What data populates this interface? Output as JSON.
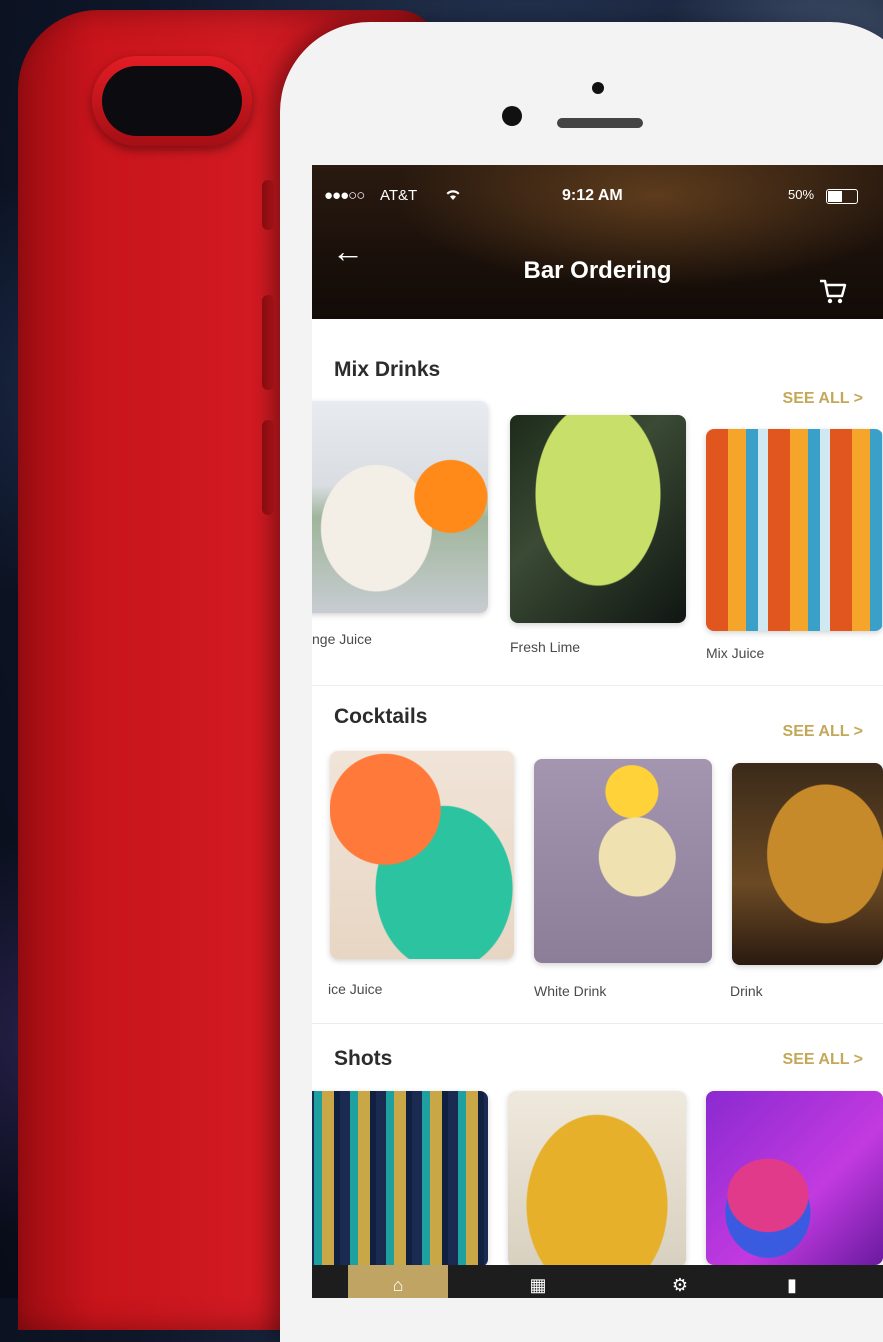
{
  "status_bar": {
    "signal": "●●●○○",
    "carrier": "AT&T",
    "time": "9:12 AM",
    "battery": "50%"
  },
  "header": {
    "title": "Bar Ordering",
    "back_icon": "back-arrow-icon",
    "cart_icon": "cart-icon"
  },
  "sections": [
    {
      "title": "Mix Drinks",
      "see_all": "SEE ALL >",
      "items": [
        {
          "label": "nge Juice"
        },
        {
          "label": "Fresh Lime"
        },
        {
          "label": "Mix Juice"
        }
      ]
    },
    {
      "title": "Cocktails",
      "see_all": "SEE ALL >",
      "items": [
        {
          "label": "ice Juice"
        },
        {
          "label": "White Drink"
        },
        {
          "label": "Drink"
        }
      ]
    },
    {
      "title": "Shots",
      "see_all": "SEE ALL >",
      "items": [
        {
          "label": ""
        },
        {
          "label": ""
        },
        {
          "label": ""
        }
      ]
    }
  ],
  "tabbar": {
    "tabs": [
      {
        "icon": "home-icon"
      },
      {
        "icon": "calendar-icon"
      },
      {
        "icon": "gear-icon"
      },
      {
        "icon": "bottle-icon"
      }
    ]
  },
  "colors": {
    "accent": "#c4a85a",
    "phone_red": "#d11a22",
    "header_dark": "#1a100a"
  }
}
